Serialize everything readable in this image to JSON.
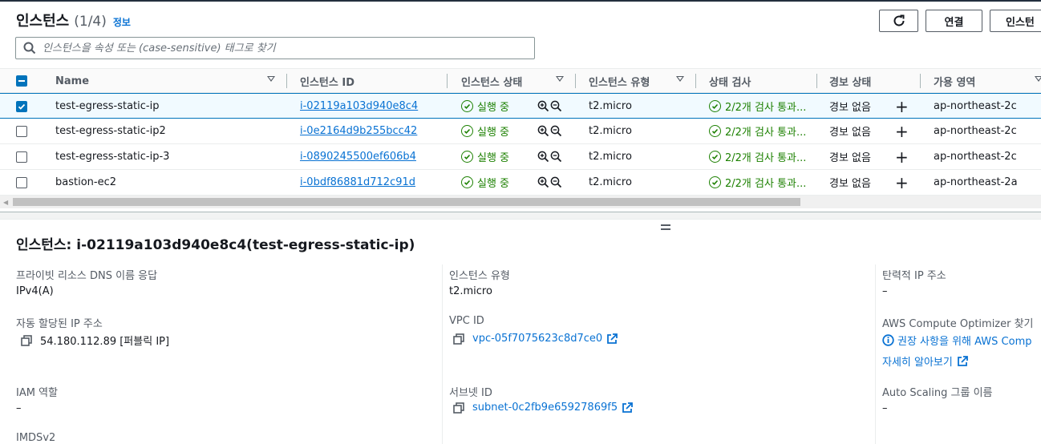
{
  "header": {
    "title": "인스턴스",
    "count": "(1/4)",
    "info_link": "정보",
    "connect_label": "연결",
    "instance_state_label": "인스턴"
  },
  "search": {
    "placeholder": "인스턴스을 속성 또는 (case-sensitive) 태그로 찾기"
  },
  "columns": {
    "name": "Name",
    "instance_id": "인스턴스 ID",
    "instance_state": "인스턴스 상태",
    "instance_type": "인스턴스 유형",
    "status_check": "상태 검사",
    "alarm_status": "경보 상태",
    "availability_zone": "가용 영역"
  },
  "rows": [
    {
      "selected": true,
      "name": "test-egress-static-ip",
      "instance_id": "i-02119a103d940e8c4",
      "state": "실행 중",
      "type": "t2.micro",
      "status_check": "2/2개 검사 통과...",
      "alarm": "경보 없음",
      "az": "ap-northeast-2c"
    },
    {
      "selected": false,
      "name": "test-egress-static-ip2",
      "instance_id": "i-0e2164d9b255bcc42",
      "state": "실행 중",
      "type": "t2.micro",
      "status_check": "2/2개 검사 통과...",
      "alarm": "경보 없음",
      "az": "ap-northeast-2c"
    },
    {
      "selected": false,
      "name": "test-egress-static-ip-3",
      "instance_id": "i-0890245500ef606b4",
      "state": "실행 중",
      "type": "t2.micro",
      "status_check": "2/2개 검사 통과...",
      "alarm": "경보 없음",
      "az": "ap-northeast-2c"
    },
    {
      "selected": false,
      "name": "bastion-ec2",
      "instance_id": "i-0bdf86881d712c91d",
      "state": "실행 중",
      "type": "t2.micro",
      "status_check": "2/2개 검사 통과...",
      "alarm": "경보 없음",
      "az": "ap-northeast-2a"
    }
  ],
  "details": {
    "title": "인스턴스: i-02119a103d940e8c4(test-egress-static-ip)",
    "col1": {
      "dns_label": "프라이빗 리소스 DNS 이름 응답",
      "dns_value": "IPv4(A)",
      "ip_label": "자동 할당된 IP 주소",
      "ip_value": "54.180.112.89 [퍼블릭 IP]",
      "iam_label": "IAM 역할",
      "iam_value": "–",
      "imds_label": "IMDSv2"
    },
    "col2": {
      "type_label": "인스턴스 유형",
      "type_value": "t2.micro",
      "vpc_label": "VPC ID",
      "vpc_value": "vpc-05f7075623c8d7ce0",
      "subnet_label": "서브넷 ID",
      "subnet_value": "subnet-0c2fb9e65927869f5"
    },
    "col3": {
      "eip_label": "탄력적 IP 주소",
      "eip_value": "–",
      "optimizer_label": "AWS Compute Optimizer 찾기",
      "optimizer_value": "권장 사항을 위해 AWS Comp",
      "learn_more": "자세히 알아보기",
      "asg_label": "Auto Scaling 그룹 이름",
      "asg_value": "–"
    }
  },
  "colors": {
    "link": "#0972d3",
    "success": "#1d8102",
    "selected_bg": "#f1faff",
    "selected_border": "#0073bb"
  }
}
